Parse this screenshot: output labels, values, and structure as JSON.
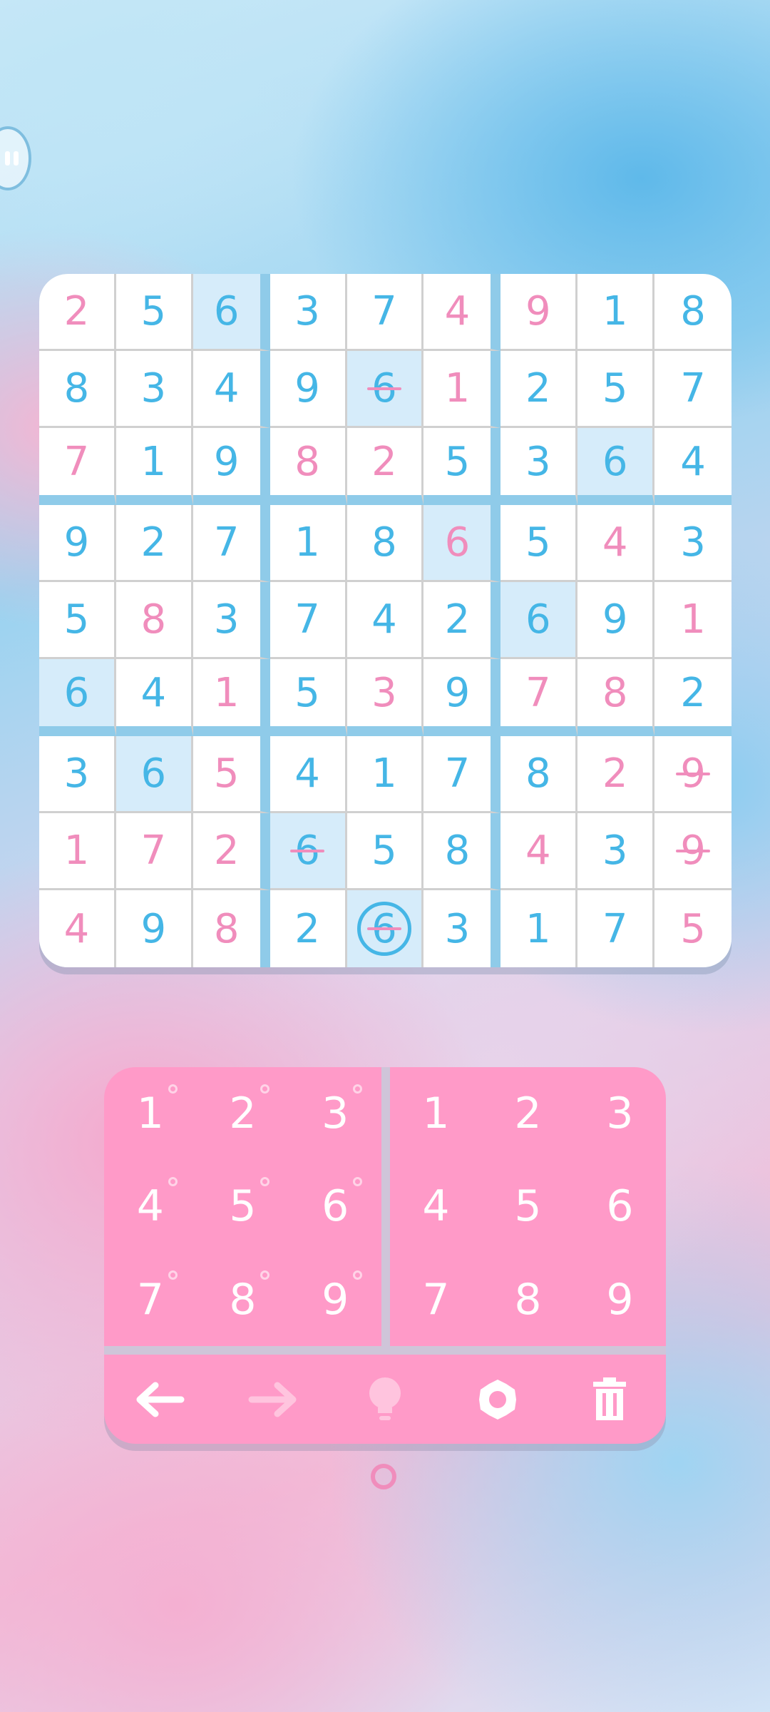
{
  "board": {
    "rows": [
      [
        {
          "v": "2",
          "c": "pink"
        },
        {
          "v": "5",
          "c": "blue"
        },
        {
          "v": "6",
          "c": "blue",
          "hl": true
        },
        {
          "v": "3",
          "c": "blue"
        },
        {
          "v": "7",
          "c": "blue"
        },
        {
          "v": "4",
          "c": "pink"
        },
        {
          "v": "9",
          "c": "pink"
        },
        {
          "v": "1",
          "c": "blue"
        },
        {
          "v": "8",
          "c": "blue"
        }
      ],
      [
        {
          "v": "8",
          "c": "blue"
        },
        {
          "v": "3",
          "c": "blue"
        },
        {
          "v": "4",
          "c": "blue"
        },
        {
          "v": "9",
          "c": "blue"
        },
        {
          "v": "6",
          "c": "blue",
          "hl": true,
          "strike": true
        },
        {
          "v": "1",
          "c": "pink"
        },
        {
          "v": "2",
          "c": "blue"
        },
        {
          "v": "5",
          "c": "blue"
        },
        {
          "v": "7",
          "c": "blue"
        }
      ],
      [
        {
          "v": "7",
          "c": "pink"
        },
        {
          "v": "1",
          "c": "blue"
        },
        {
          "v": "9",
          "c": "blue"
        },
        {
          "v": "8",
          "c": "pink"
        },
        {
          "v": "2",
          "c": "pink"
        },
        {
          "v": "5",
          "c": "blue"
        },
        {
          "v": "3",
          "c": "blue"
        },
        {
          "v": "6",
          "c": "blue",
          "hl": true
        },
        {
          "v": "4",
          "c": "blue"
        }
      ],
      [
        {
          "v": "9",
          "c": "blue"
        },
        {
          "v": "2",
          "c": "blue"
        },
        {
          "v": "7",
          "c": "blue"
        },
        {
          "v": "1",
          "c": "blue"
        },
        {
          "v": "8",
          "c": "blue"
        },
        {
          "v": "6",
          "c": "pink",
          "hl": true
        },
        {
          "v": "5",
          "c": "blue"
        },
        {
          "v": "4",
          "c": "pink"
        },
        {
          "v": "3",
          "c": "blue"
        }
      ],
      [
        {
          "v": "5",
          "c": "blue"
        },
        {
          "v": "8",
          "c": "pink"
        },
        {
          "v": "3",
          "c": "blue"
        },
        {
          "v": "7",
          "c": "blue"
        },
        {
          "v": "4",
          "c": "blue"
        },
        {
          "v": "2",
          "c": "blue"
        },
        {
          "v": "6",
          "c": "blue",
          "hl": true
        },
        {
          "v": "9",
          "c": "blue"
        },
        {
          "v": "1",
          "c": "pink"
        }
      ],
      [
        {
          "v": "6",
          "c": "blue",
          "hl": true
        },
        {
          "v": "4",
          "c": "blue"
        },
        {
          "v": "1",
          "c": "pink"
        },
        {
          "v": "5",
          "c": "blue"
        },
        {
          "v": "3",
          "c": "pink"
        },
        {
          "v": "9",
          "c": "blue"
        },
        {
          "v": "7",
          "c": "pink"
        },
        {
          "v": "8",
          "c": "pink"
        },
        {
          "v": "2",
          "c": "blue"
        }
      ],
      [
        {
          "v": "3",
          "c": "blue"
        },
        {
          "v": "6",
          "c": "blue",
          "hl": true
        },
        {
          "v": "5",
          "c": "pink"
        },
        {
          "v": "4",
          "c": "blue"
        },
        {
          "v": "1",
          "c": "blue"
        },
        {
          "v": "7",
          "c": "blue"
        },
        {
          "v": "8",
          "c": "blue"
        },
        {
          "v": "2",
          "c": "pink"
        },
        {
          "v": "9",
          "c": "pink",
          "strike": true
        }
      ],
      [
        {
          "v": "1",
          "c": "pink"
        },
        {
          "v": "7",
          "c": "pink"
        },
        {
          "v": "2",
          "c": "pink"
        },
        {
          "v": "6",
          "c": "blue",
          "hl": true,
          "strike": true
        },
        {
          "v": "5",
          "c": "blue"
        },
        {
          "v": "8",
          "c": "blue"
        },
        {
          "v": "4",
          "c": "pink"
        },
        {
          "v": "3",
          "c": "blue"
        },
        {
          "v": "9",
          "c": "pink",
          "strike": true
        }
      ],
      [
        {
          "v": "4",
          "c": "pink"
        },
        {
          "v": "9",
          "c": "blue"
        },
        {
          "v": "8",
          "c": "pink"
        },
        {
          "v": "2",
          "c": "blue"
        },
        {
          "v": "6",
          "c": "blue",
          "hl": true,
          "strike": true,
          "selected": true
        },
        {
          "v": "3",
          "c": "blue"
        },
        {
          "v": "1",
          "c": "blue"
        },
        {
          "v": "7",
          "c": "blue"
        },
        {
          "v": "5",
          "c": "pink"
        }
      ]
    ]
  },
  "keypad": {
    "notes_keys": [
      "1",
      "2",
      "3",
      "4",
      "5",
      "6",
      "7",
      "8",
      "9"
    ],
    "value_keys": [
      "1",
      "2",
      "3",
      "4",
      "5",
      "6",
      "7",
      "8",
      "9"
    ]
  },
  "toolbar": {
    "icons": [
      "undo-arrow-icon",
      "redo-arrow-icon",
      "hint-bulb-icon",
      "settings-gear-icon",
      "delete-trash-icon"
    ]
  },
  "colors": {
    "accent_blue": "#45b6e6",
    "accent_pink": "#f08dbc",
    "pad_pink": "#ff9ac8",
    "highlight": "#d6ecfa"
  }
}
